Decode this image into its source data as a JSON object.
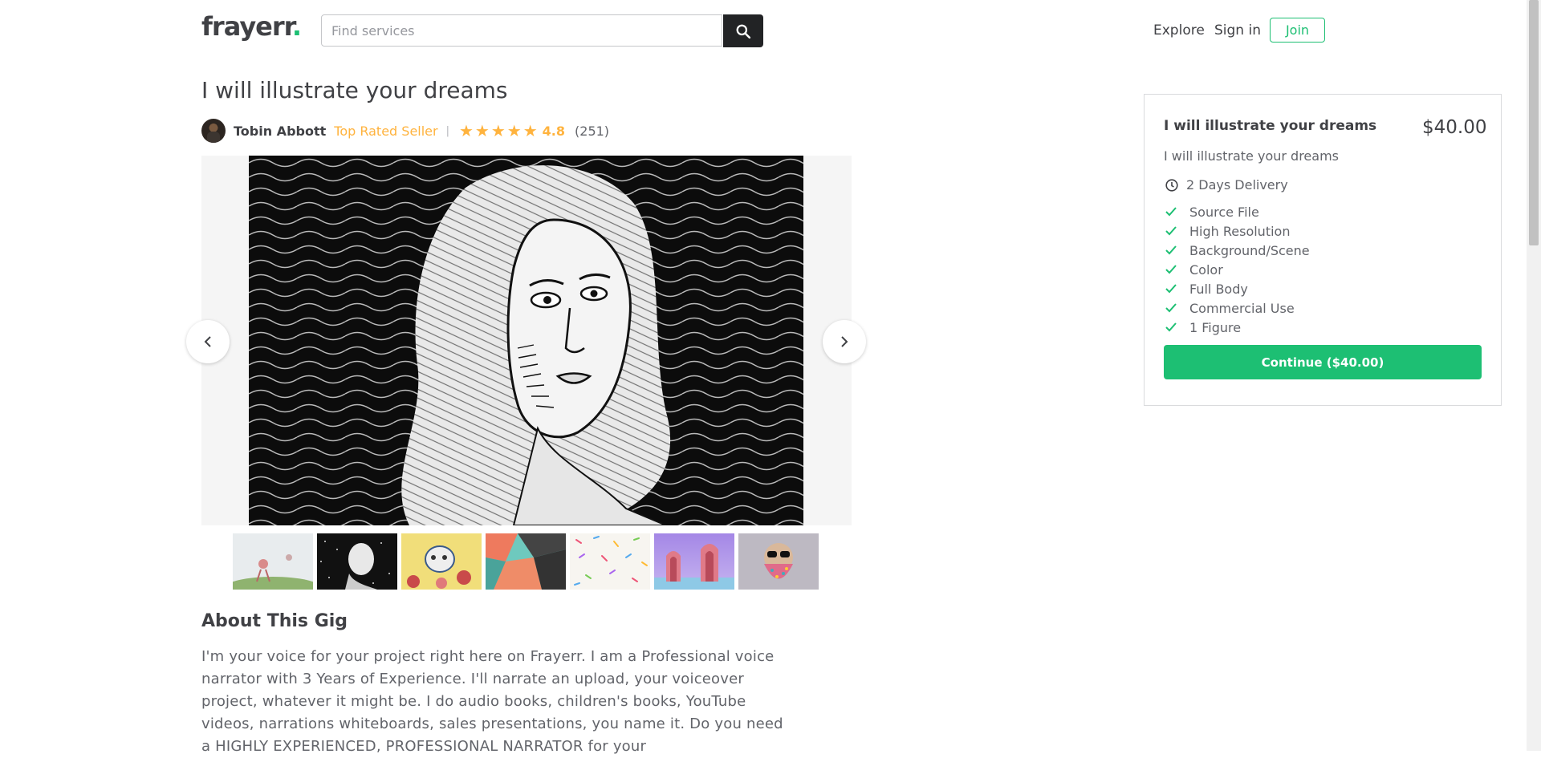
{
  "header": {
    "logo_text": "frayerr",
    "logo_dot": ".",
    "search_placeholder": "Find services",
    "nav": {
      "explore": "Explore",
      "sign_in": "Sign in",
      "join": "Join"
    }
  },
  "gig": {
    "title": "I will illustrate your dreams",
    "seller": {
      "name": "Tobin Abbott",
      "level": "Top Rated Seller",
      "separator": "|",
      "rating": "4.8",
      "reviews": "(251)",
      "stars": 5
    },
    "gallery": {
      "thumbnail_count": 7,
      "active_index": 1
    }
  },
  "about": {
    "title": "About This Gig",
    "text": "I'm your voice for your project right here on Frayerr. I am a Professional voice narrator with 3 Years of Experience. I'll narrate an upload, your voiceover project, whatever it might be. I do audio books, children's books, YouTube videos, narrations whiteboards, sales presentations, you name it. Do you need a HIGHLY EXPERIENCED, PROFESSIONAL NARRATOR for your"
  },
  "package": {
    "title": "I will illustrate your dreams",
    "price": "$40.00",
    "description": "I will illustrate your dreams",
    "delivery": "2 Days Delivery",
    "features": [
      "Source File",
      "High Resolution",
      "Background/Scene",
      "Color",
      "Full Body",
      "Commercial Use",
      "1 Figure"
    ],
    "cta": "Continue ($40.00)"
  },
  "colors": {
    "brand_green": "#1dbf73",
    "star_gold": "#ffb33e",
    "text_dark": "#404145",
    "text_muted": "#62646a"
  }
}
